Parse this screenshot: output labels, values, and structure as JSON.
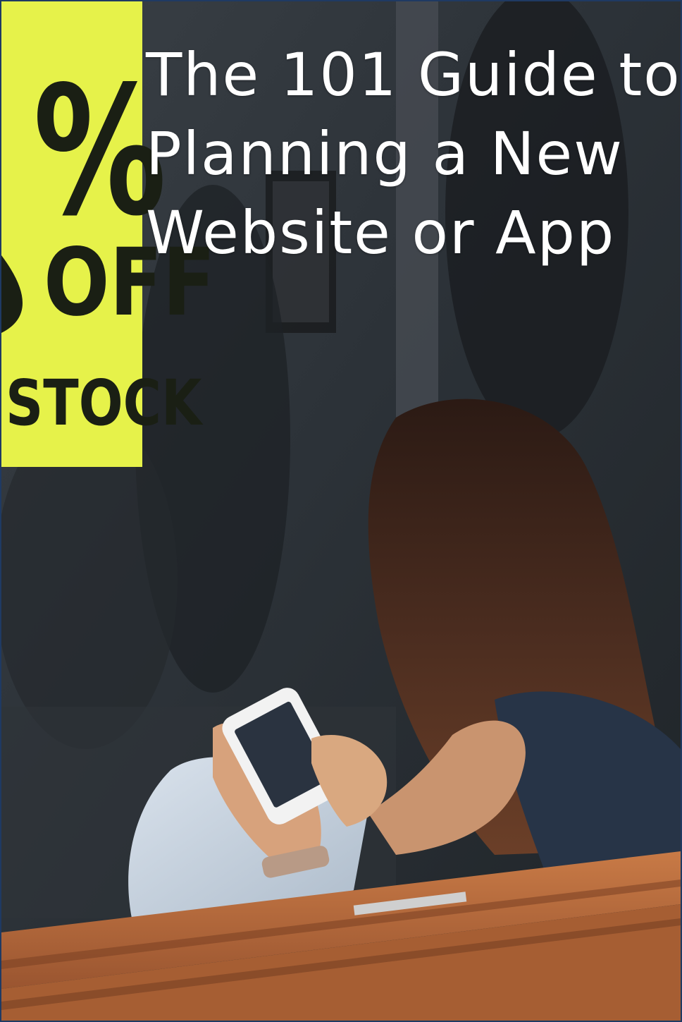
{
  "title": {
    "line1": "The 101 Guide to",
    "line2": "Planning a New",
    "line3": "Website or App"
  },
  "sign": {
    "percent": "%",
    "off": "OFF",
    "stock": "STOCK"
  },
  "colors": {
    "sign_yellow": "#e6f24a",
    "hair": "#3a2218",
    "bench": "#b5683a",
    "border": "#1f3a63"
  }
}
